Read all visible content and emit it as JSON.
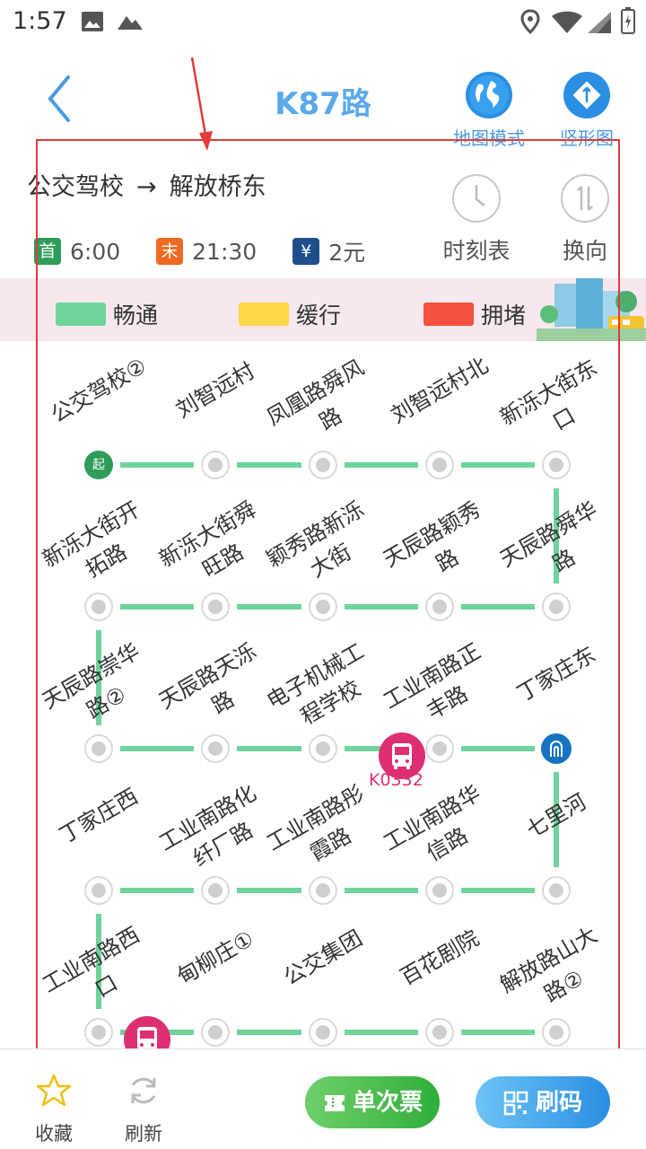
{
  "status_bar": {
    "time": "1:57"
  },
  "header": {
    "title": "K87路",
    "map_mode_label": "地图模式",
    "vertical_label": "竖形图"
  },
  "route": {
    "from": "公交驾校",
    "arrow": "→",
    "to": "解放桥东",
    "first_badge": "首",
    "first_time": "6:00",
    "last_badge": "末",
    "last_time": "21:30",
    "fare_badge": "¥",
    "fare": "2元",
    "timetable_label": "时刻表",
    "reverse_label": "换向"
  },
  "legend": {
    "smooth": "畅通",
    "slow": "缓行",
    "congested": "拥堵",
    "colors": {
      "smooth": "#6fd49b",
      "slow": "#ffd84a",
      "congested": "#f4513e"
    }
  },
  "stops": [
    "公交驾校②",
    "刘智远村",
    "凤凰路舜风路",
    "刘智远村北",
    "新泺大街东口",
    "天辰路舜华路",
    "天辰路颖秀路",
    "颖秀路新泺大街",
    "新泺大街舜旺路",
    "新泺大街开拓路",
    "天辰路崇华路②",
    "天辰路天泺路",
    "电子机械工程学校",
    "工业南路正丰路",
    "丁家庄东",
    "七里河",
    "工业南路华信路",
    "工业南路彤霞路",
    "工业南路化纤厂路",
    "丁家庄西",
    "工业南路西口",
    "甸柳庄①",
    "公交集团",
    "百花剧院",
    "解放路山大路②"
  ],
  "start_marker": "起",
  "buses": [
    {
      "label": "K0332"
    }
  ],
  "bottom": {
    "favorite_label": "收藏",
    "refresh_label": "刷新",
    "single_ticket_label": "单次票",
    "scan_label": "刷码"
  }
}
